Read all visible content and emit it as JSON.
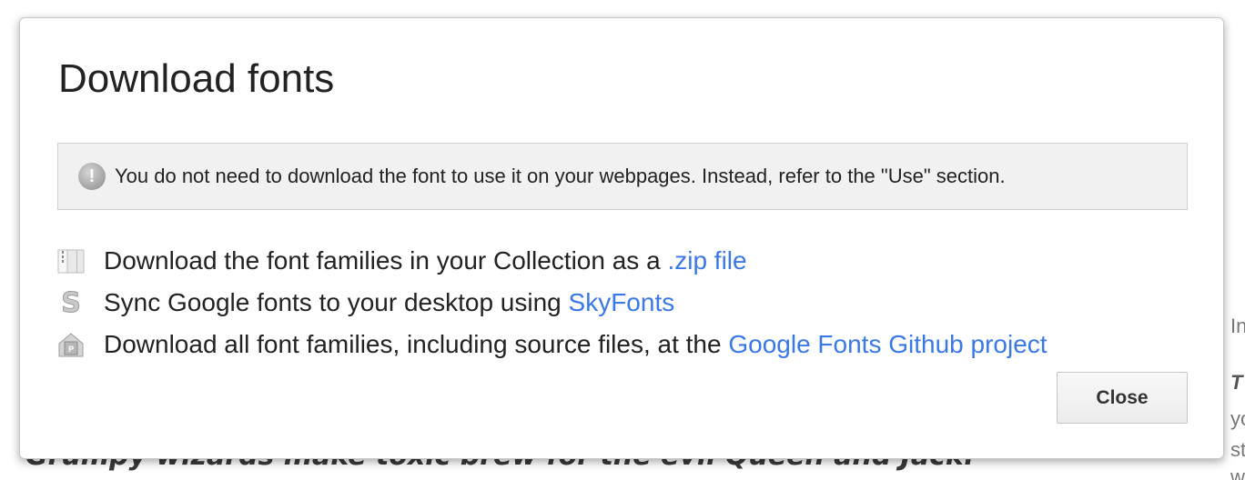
{
  "background": {
    "sample_text": "Grumpy wizards make toxic brew for the evil Queen and Jack.",
    "side_fragments": [
      "In",
      "T",
      "yo",
      "st",
      "w"
    ]
  },
  "dialog": {
    "title": "Download fonts",
    "notice": {
      "icon": "exclamation-icon",
      "text": "You do not need to download the font to use it on your webpages. Instead, refer to the \"Use\" section."
    },
    "options": [
      {
        "icon": "zip-archive-icon",
        "text": "Download the font families in your Collection as a ",
        "link": ".zip file"
      },
      {
        "icon": "skyfonts-icon",
        "text": "Sync Google fonts to your desktop using ",
        "link": "SkyFonts"
      },
      {
        "icon": "github-icon",
        "text": "Download all font families, including source files, at the ",
        "link": "Google Fonts Github project"
      }
    ],
    "close_label": "Close"
  },
  "colors": {
    "link": "#3b78e7",
    "notice_bg": "#f1f1f1",
    "text": "#222222"
  }
}
